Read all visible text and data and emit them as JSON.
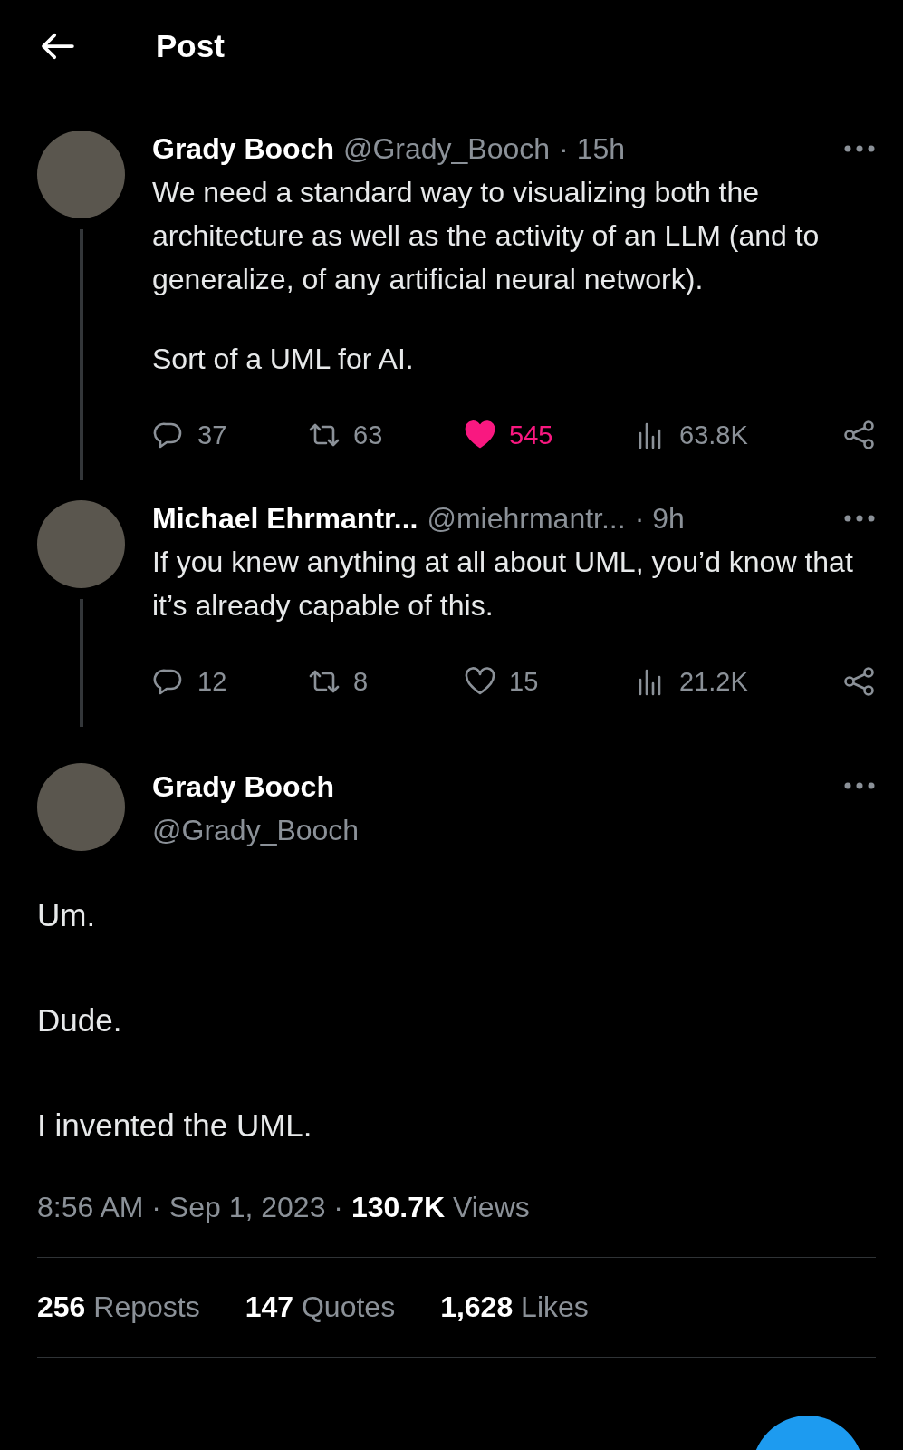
{
  "header": {
    "title": "Post"
  },
  "thread": [
    {
      "name": "Grady Booch",
      "handle": "@Grady_Booch",
      "time": "· 15h",
      "paragraphs": [
        "We need a standard way to visualizing both the architecture as well as the activity of an LLM (and to generalize, of any artificial neural network).",
        "Sort of a UML for AI."
      ],
      "replies": "37",
      "reposts": "63",
      "likes": "545",
      "liked": true,
      "views": "63.8K"
    },
    {
      "name": "Michael Ehrmantr...",
      "handle": "@miehrmantr...",
      "time": "· 9h",
      "paragraphs": [
        "If you knew anything at all about UML, you’d know that it’s already capable of this."
      ],
      "replies": "12",
      "reposts": "8",
      "likes": "15",
      "liked": false,
      "views": "21.2K"
    }
  ],
  "main": {
    "name": "Grady Booch",
    "handle": "@Grady_Booch",
    "paragraphs": [
      "Um.",
      "Dude.",
      "I invented the UML."
    ],
    "meta": "8:56 AM · Sep 1, 2023 · **130.7K** Views",
    "counts": [
      {
        "count": "256",
        "label": "Reposts"
      },
      {
        "count": "147",
        "label": "Quotes"
      },
      {
        "count": "1,628",
        "label": "Likes"
      }
    ]
  }
}
